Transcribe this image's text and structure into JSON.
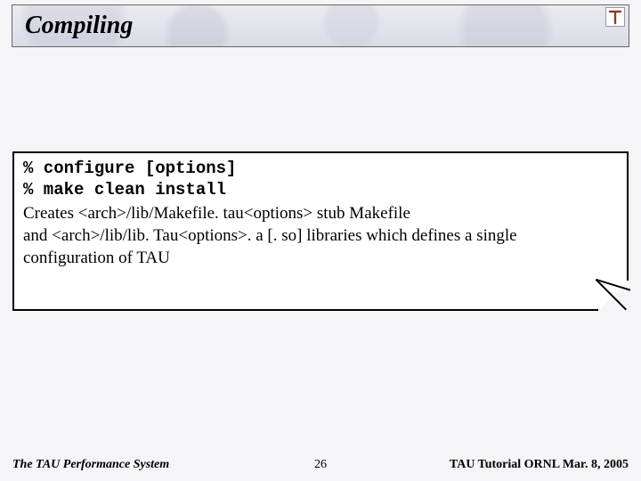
{
  "title": "Compiling",
  "logo": {
    "glyph": "τ",
    "name": "tau-logo"
  },
  "code": {
    "line1": "% configure [options]",
    "line2": "% make clean install"
  },
  "description": {
    "line1": "Creates <arch>/lib/Makefile. tau<options> stub Makefile",
    "line2": "and <arch>/lib/lib. Tau<options>. a [. so] libraries which defines a single",
    "line3": "configuration of TAU"
  },
  "footer": {
    "left": "The TAU Performance System",
    "center": "26",
    "right": "TAU Tutorial ORNL Mar. 8, 2005"
  }
}
